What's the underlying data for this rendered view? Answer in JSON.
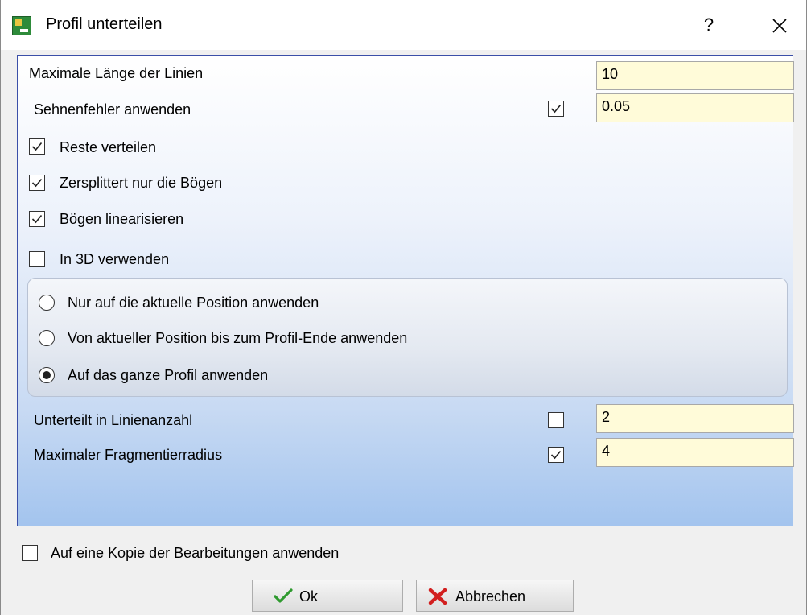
{
  "window": {
    "title": "Profil unterteilen",
    "help_label": "?"
  },
  "max_line_length": {
    "label": "Maximale Länge der Linien",
    "value": "10"
  },
  "chord_error": {
    "label": "Sehnenfehler anwenden",
    "checked": true,
    "value": "0.05"
  },
  "options": [
    {
      "label": "Reste verteilen",
      "checked": true
    },
    {
      "label": "Zersplittert nur die Bögen",
      "checked": true
    },
    {
      "label": "Bögen linearisieren",
      "checked": true
    },
    {
      "label": "In 3D verwenden",
      "checked": false
    }
  ],
  "scope": {
    "options": [
      "Nur auf die aktuelle Position anwenden",
      "Von aktueller Position bis zum Profil-Ende anwenden",
      "Auf das ganze Profil anwenden"
    ],
    "selected_index": 2
  },
  "line_count": {
    "label": "Unterteilt in Linienanzahl",
    "checked": false,
    "value": "2"
  },
  "max_fragment_radius": {
    "label": "Maximaler Fragmentierradius",
    "checked": true,
    "value": "4"
  },
  "copy_option": {
    "label": "Auf eine Kopie der Bearbeitungen anwenden",
    "checked": false
  },
  "buttons": {
    "ok": "Ok",
    "cancel": "Abbrechen"
  },
  "icons": {
    "ok": "check-icon",
    "cancel": "red-x-icon",
    "app": "app-icon",
    "close": "close-icon"
  },
  "colors": {
    "input_bg": "#fffbd9",
    "panel_border": "#3b4fa8",
    "panel_gradient_end": "#a3c4ee"
  }
}
